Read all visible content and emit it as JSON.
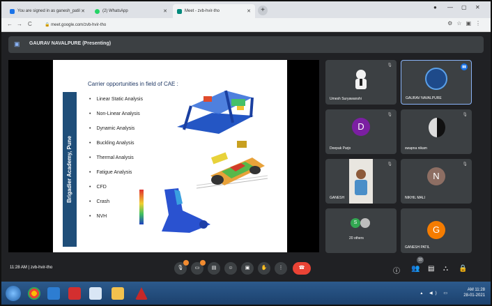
{
  "browser": {
    "tabs": [
      {
        "label": "You are signed in as ganesh_patil",
        "active": false,
        "color": "#1a73e8"
      },
      {
        "label": "(2) WhatsApp",
        "active": false,
        "color": "#25d366"
      },
      {
        "label": "Meet - zvb-hvir-tho",
        "active": true,
        "color": "#00897b"
      }
    ],
    "url": "meet.google.com/zvb-hvir-tho"
  },
  "meet": {
    "presenter_label": "GAURAV NAVALPURE (Presenting)",
    "meeting_time": "11:28 AM",
    "meeting_code": "zvb-hvir-tho",
    "participants_count": "10"
  },
  "slide": {
    "title": "Carrier opportunities in field of CAE :",
    "band_text": "Brigadier Academy, Pune",
    "bullets": [
      "Linear Static Analysis",
      "Non-Linear Analysis",
      "Dynamic Analysis",
      "Buckling Analysis",
      "Thermal Analysis",
      "Fatigue Analysis",
      "CFD",
      "Crash",
      "NVH"
    ]
  },
  "tiles": [
    {
      "name": "Umesh Suryawanshi",
      "kind": "photo",
      "mic": "off"
    },
    {
      "name": "GAURAV NAVALPURE",
      "kind": "logo",
      "mic": "on"
    },
    {
      "name": "Deepak Parjo",
      "kind": "avatar",
      "initial": "D",
      "color": "#7b1fa2",
      "mic": "off"
    },
    {
      "name": "swapna nikam",
      "kind": "photo",
      "mic": "off"
    },
    {
      "name": "GANESH",
      "kind": "video",
      "mic": "off"
    },
    {
      "name": "NIKHIL MALI",
      "kind": "avatar",
      "initial": "N",
      "color": "#8d6e63",
      "mic": "off"
    },
    {
      "name": "20 others",
      "kind": "group",
      "initial": "S",
      "color": "#33a852"
    },
    {
      "name": "GANESH PATIL",
      "kind": "avatar",
      "initial": "G",
      "color": "#f57c00",
      "mic": "off"
    }
  ],
  "taskbar": {
    "time": "AM 11:28",
    "date": "28-01-2021"
  }
}
